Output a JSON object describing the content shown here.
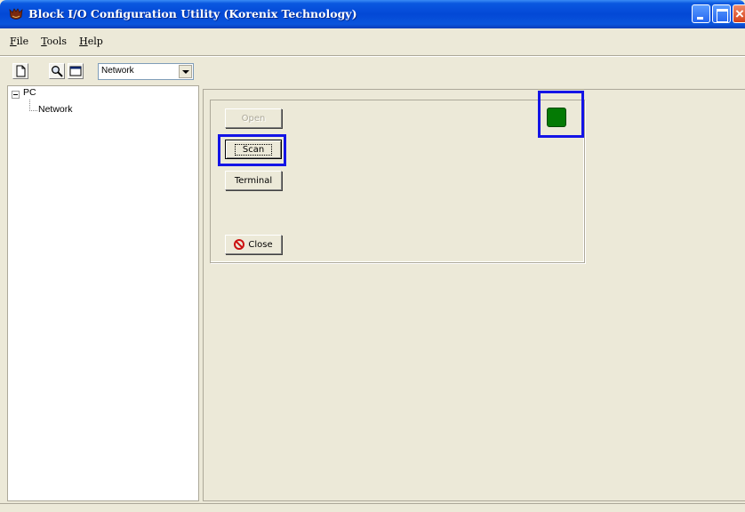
{
  "window": {
    "title": "Block I/O Configuration Utility (Korenix Technology)"
  },
  "menu": [
    {
      "label": "File",
      "accel": "F",
      "rest": "ile"
    },
    {
      "label": "Tools",
      "accel": "T",
      "rest": "ools"
    },
    {
      "label": "Help",
      "accel": "H",
      "rest": "elp"
    }
  ],
  "toolbar": {
    "new_icon": "new-document-icon",
    "search_icon": "magnifier-icon",
    "window_icon": "window-icon",
    "selector_value": "Network"
  },
  "tree": {
    "root": "PC",
    "child": "Network"
  },
  "panel": {
    "open_label": "Open",
    "scan_label": "Scan",
    "terminal_label": "Terminal",
    "close_label": "Close"
  },
  "status": {
    "led_color": "#047a04"
  },
  "colors": {
    "title_bar": "#0348d6",
    "highlight": "#1414e6",
    "led": "#047a04"
  }
}
